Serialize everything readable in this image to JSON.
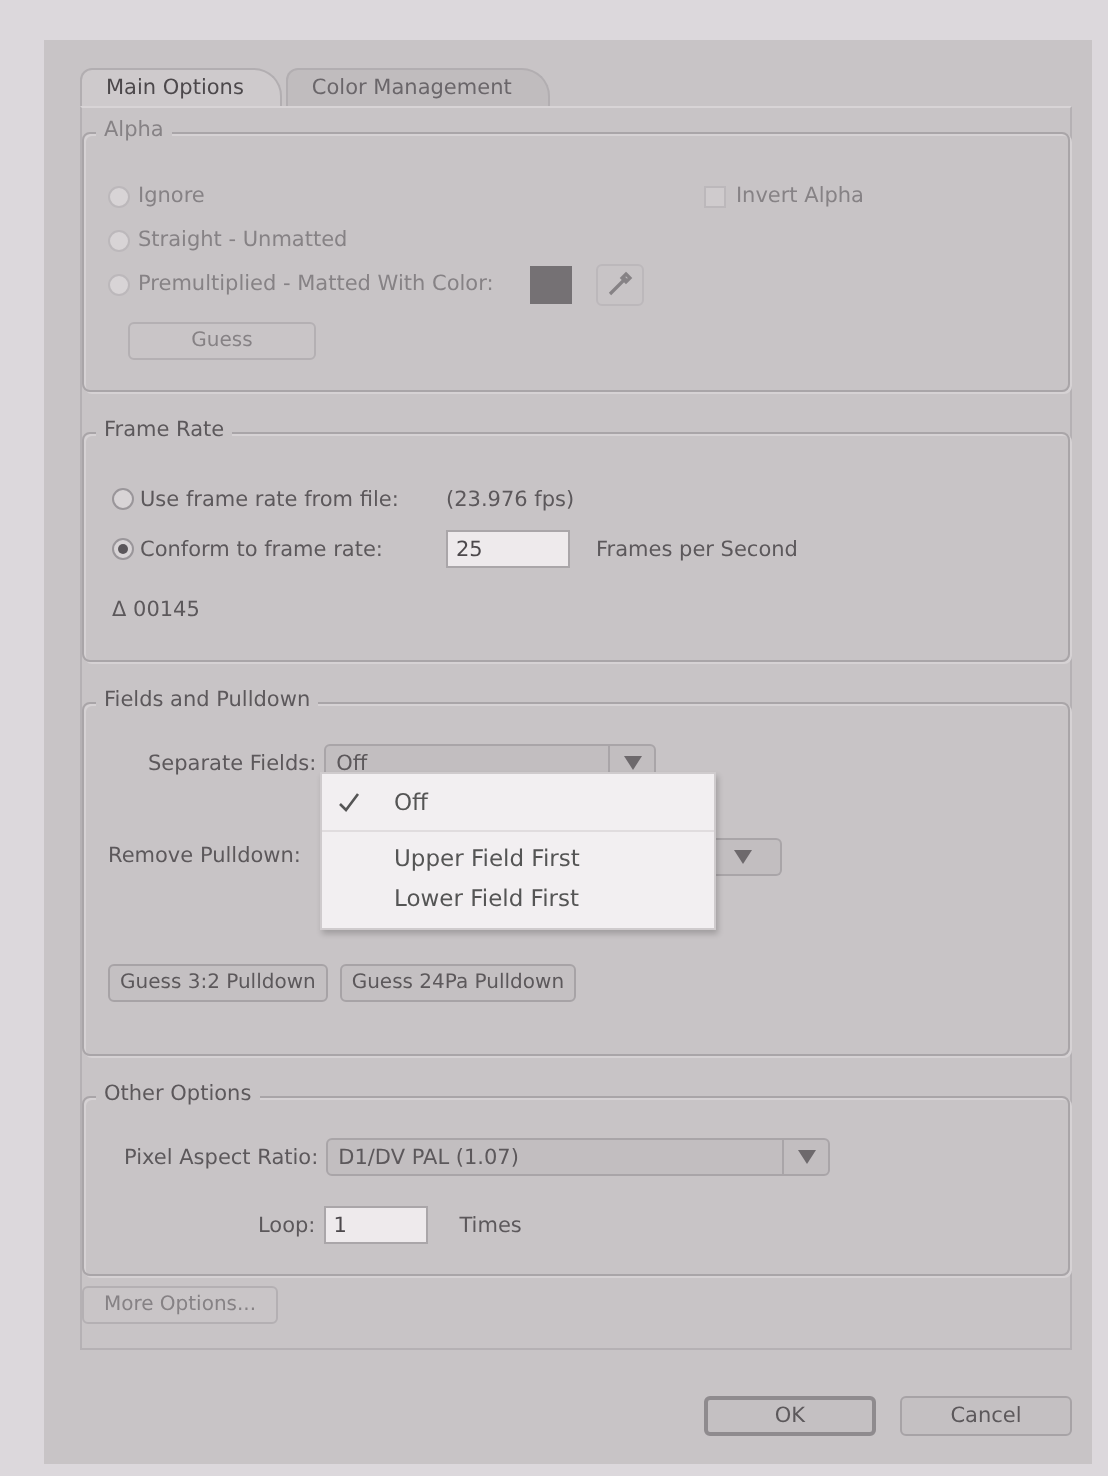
{
  "tabs": [
    {
      "label": "Main Options",
      "selected": true
    },
    {
      "label": "Color Management",
      "selected": false
    }
  ],
  "alpha": {
    "title": "Alpha",
    "disabled": true,
    "options": [
      {
        "label": "Ignore",
        "selected": false
      },
      {
        "label": "Straight - Unmatted",
        "selected": false
      },
      {
        "label": "Premultiplied - Matted With Color:",
        "selected": false
      }
    ],
    "invert_alpha": {
      "label": "Invert Alpha",
      "checked": false
    },
    "guess_button": "Guess"
  },
  "frame_rate": {
    "title": "Frame Rate",
    "options": [
      {
        "label": "Use frame rate from file:",
        "selected": false,
        "note": "(23.976 fps)"
      },
      {
        "label": "Conform to frame rate:",
        "selected": true,
        "value": "25",
        "unit": "Frames per Second"
      }
    ],
    "duration": "Δ 00145"
  },
  "fields": {
    "title": "Fields and Pulldown",
    "separate_fields": {
      "label": "Separate Fields:",
      "value": "Off"
    },
    "menu": [
      {
        "label": "Off",
        "selected": true
      },
      {
        "label": "Upper Field First",
        "selected": false
      },
      {
        "label": "Lower Field First",
        "selected": false
      }
    ],
    "remove_pulldown": {
      "label": "Remove Pulldown:"
    },
    "buttons": [
      "Guess 3:2 Pulldown",
      "Guess 24Pa Pulldown"
    ]
  },
  "other": {
    "title": "Other Options",
    "pixel_aspect": {
      "label": "Pixel Aspect Ratio:",
      "value": "D1/DV PAL (1.07)"
    },
    "loop": {
      "label": "Loop:",
      "value": "1",
      "unit": "Times"
    }
  },
  "more_options": {
    "label": "More Options...",
    "disabled": true
  },
  "buttons": [
    {
      "label": "OK",
      "default": true
    },
    {
      "label": "Cancel",
      "default": false
    }
  ]
}
